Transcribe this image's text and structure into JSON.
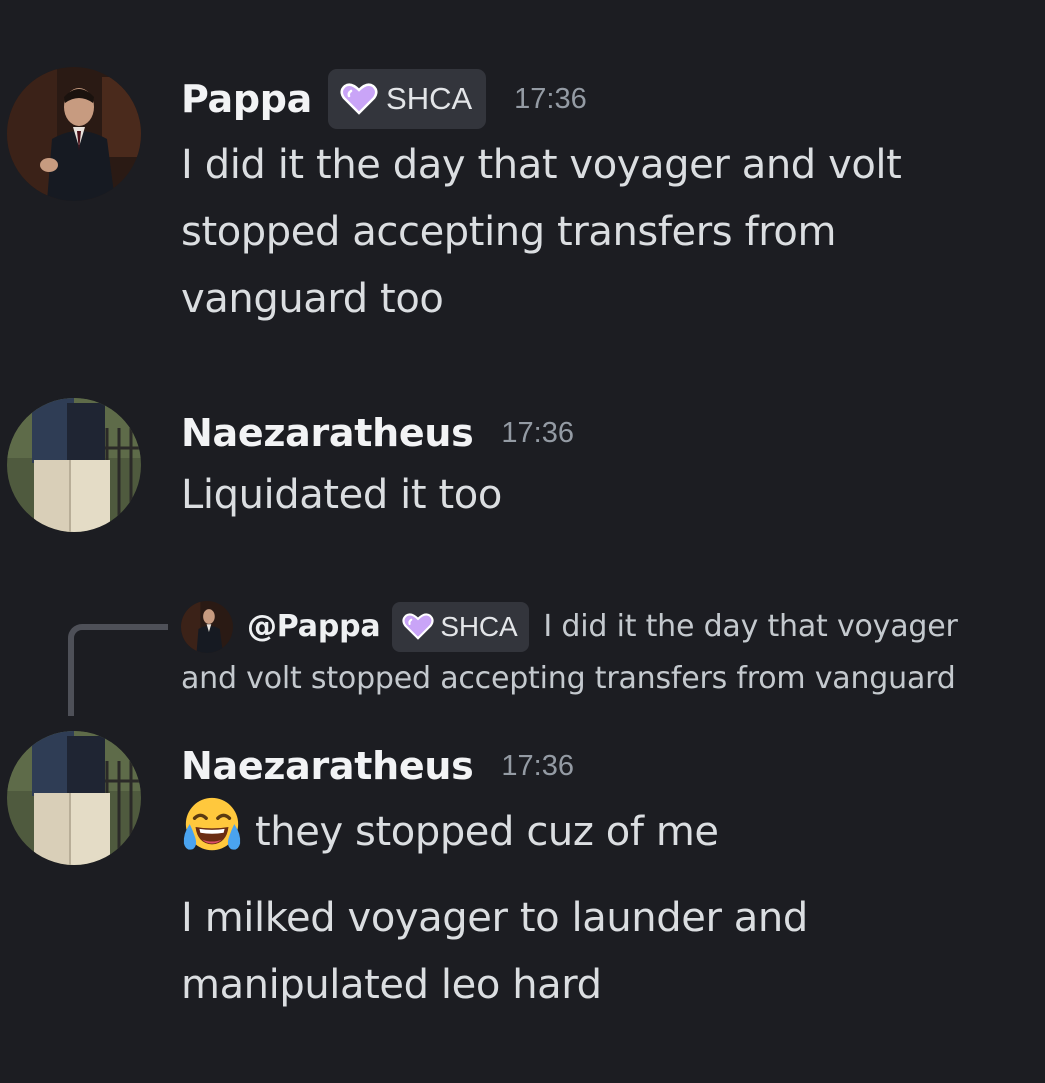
{
  "messages": [
    {
      "username": "Pappa",
      "tag": "SHCA",
      "timestamp": "17:36",
      "lines": [
        "I did it the day that voyager and volt",
        "stopped accepting transfers from",
        "vanguard too"
      ]
    },
    {
      "username": "Naezaratheus",
      "timestamp": "17:36",
      "lines": [
        "Liquidated it too"
      ]
    },
    {
      "reply": {
        "mention": "@Pappa",
        "tag": "SHCA",
        "text_line1": "I did it the day that voyager",
        "text_line2": "and volt stopped accepting transfers from vanguard"
      },
      "username": "Naezaratheus",
      "timestamp": "17:36",
      "emoji": "face-with-tears-of-joy-icon",
      "line1": "they stopped cuz of me",
      "line2a": "I milked voyager to launder and",
      "line2b": "manipulated leo hard"
    }
  ],
  "colors": {
    "background": "#1c1d22",
    "username": "#f2f3f5",
    "message_text": "#dbdee1",
    "timestamp": "#949ba4",
    "tag_background": "#33353c",
    "tag_heart": "#c9a4f7"
  }
}
